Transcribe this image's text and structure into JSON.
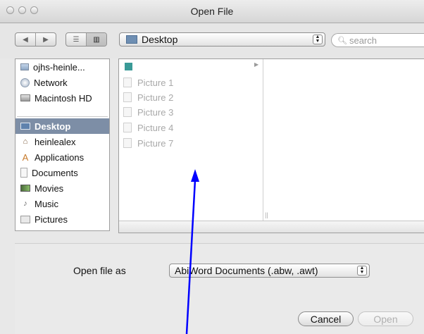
{
  "window": {
    "title": "Open File"
  },
  "toolbar": {
    "back_label": "◀",
    "forward_label": "▶",
    "list_view_label": "☰",
    "column_view_label": "▥",
    "location": "Desktop",
    "search_placeholder": "search"
  },
  "sidebar": {
    "devices": [
      {
        "label": "ojhs-heinle...",
        "icon": "computer-icon"
      },
      {
        "label": "Network",
        "icon": "network-icon"
      },
      {
        "label": "Macintosh HD",
        "icon": "hard-drive-icon"
      }
    ],
    "places": [
      {
        "label": "Desktop",
        "icon": "desktop-icon",
        "selected": true
      },
      {
        "label": "heinlealex",
        "icon": "home-icon"
      },
      {
        "label": "Applications",
        "icon": "applications-icon"
      },
      {
        "label": "Documents",
        "icon": "documents-icon"
      },
      {
        "label": "Movies",
        "icon": "movies-icon"
      },
      {
        "label": "Music",
        "icon": "music-icon"
      },
      {
        "label": "Pictures",
        "icon": "pictures-icon"
      }
    ]
  },
  "browser": {
    "files": [
      "Picture 1",
      "Picture 2",
      "Picture 3",
      "Picture 4",
      "Picture 7"
    ]
  },
  "options": {
    "open_as_label": "Open file as",
    "file_type": "AbiWord Documents (.abw, .awt)"
  },
  "buttons": {
    "cancel": "Cancel",
    "open": "Open"
  },
  "colors": {
    "selection": "#7d8ea6",
    "annotation_arrow": "#0000ff"
  }
}
